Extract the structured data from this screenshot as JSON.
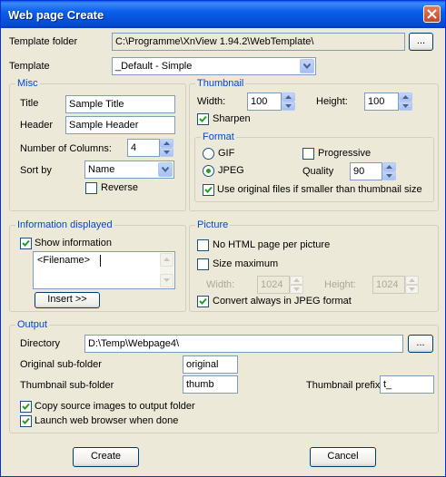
{
  "window": {
    "title": "Web page Create"
  },
  "template_folder": {
    "label": "Template folder",
    "value": "C:\\Programme\\XnView 1.94.2\\WebTemplate\\",
    "browse_label": "..."
  },
  "template": {
    "label": "Template",
    "value": "_Default - Simple"
  },
  "misc": {
    "title": "Misc",
    "title_label": "Title",
    "title_value": "Sample Title",
    "header_label": "Header",
    "header_value": "Sample Header",
    "columns_label": "Number of Columns:",
    "columns_value": "4",
    "sortby_label": "Sort by",
    "sortby_value": "Name",
    "reverse_label": "Reverse",
    "reverse_checked": false
  },
  "thumbnail": {
    "title": "Thumbnail",
    "width_label": "Width:",
    "width_value": "100",
    "height_label": "Height:",
    "height_value": "100",
    "sharpen_label": "Sharpen",
    "sharpen_checked": true
  },
  "format": {
    "title": "Format",
    "gif_label": "GIF",
    "jpeg_label": "JPEG",
    "selected": "JPEG",
    "progressive_label": "Progressive",
    "progressive_checked": false,
    "quality_label": "Quality",
    "quality_value": "90",
    "use_original_label": "Use original files if smaller than thumbnail size",
    "use_original_checked": true
  },
  "info": {
    "title": "Information displayed",
    "show_label": "Show information",
    "show_checked": true,
    "text": "<Filename>",
    "insert_label": "Insert >>"
  },
  "picture": {
    "title": "Picture",
    "no_html_label": "No HTML page per picture",
    "no_html_checked": false,
    "size_max_label": "Size maximum",
    "size_max_checked": false,
    "width_label": "Width:",
    "width_value": "1024",
    "height_label": "Height:",
    "height_value": "1024",
    "convert_label": "Convert always in JPEG format",
    "convert_checked": true
  },
  "output": {
    "title": "Output",
    "directory_label": "Directory",
    "directory_value": "D:\\Temp\\Webpage4\\",
    "browse_label": "...",
    "orig_sub_label": "Original sub-folder",
    "orig_sub_value": "original",
    "thumb_sub_label": "Thumbnail sub-folder",
    "thumb_sub_value": "thumb",
    "thumb_prefix_label": "Thumbnail prefix",
    "thumb_prefix_value": "t_",
    "copy_label": "Copy source images to output folder",
    "copy_checked": true,
    "launch_label": "Launch web browser when done",
    "launch_checked": true
  },
  "buttons": {
    "create_label": "Create",
    "cancel_label": "Cancel"
  },
  "colors": {
    "titlebar": "#0a5fe9",
    "dialog_bg": "#ece9d8",
    "group_title": "#0046d5",
    "check_mark": "#21a121"
  }
}
